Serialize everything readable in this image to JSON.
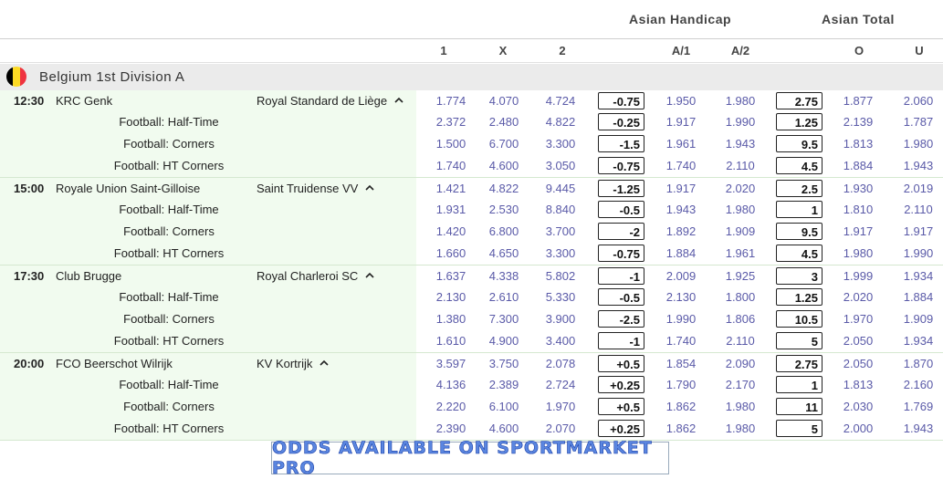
{
  "header": {
    "asian_handicap": "Asian Handicap",
    "asian_total": "Asian Total"
  },
  "columns": [
    "1",
    "X",
    "2",
    "A/1",
    "A/2",
    "O",
    "U"
  ],
  "league": {
    "name": "Belgium 1st Division A",
    "flag_colors": [
      "#000000",
      "#fdda24",
      "#ef3340"
    ]
  },
  "matches": [
    {
      "time": "12:30",
      "home": "KRC Genk",
      "away": "Royal Standard de Liège",
      "rows": [
        {
          "market": "",
          "odds": [
            "1.774",
            "4.070",
            "4.724"
          ],
          "ah": "-0.75",
          "a1": "1.950",
          "a2": "1.980",
          "total": "2.75",
          "o": "1.877",
          "u": "2.060"
        },
        {
          "market": "Football: Half-Time",
          "odds": [
            "2.372",
            "2.480",
            "4.822"
          ],
          "ah": "-0.25",
          "a1": "1.917",
          "a2": "1.990",
          "total": "1.25",
          "o": "2.139",
          "u": "1.787"
        },
        {
          "market": "Football: Corners",
          "odds": [
            "1.500",
            "6.700",
            "3.300"
          ],
          "ah": "-1.5",
          "a1": "1.961",
          "a2": "1.943",
          "total": "9.5",
          "o": "1.813",
          "u": "1.980"
        },
        {
          "market": "Football: HT Corners",
          "odds": [
            "1.740",
            "4.600",
            "3.050"
          ],
          "ah": "-0.75",
          "a1": "1.740",
          "a2": "2.110",
          "total": "4.5",
          "o": "1.884",
          "u": "1.943"
        }
      ]
    },
    {
      "time": "15:00",
      "home": "Royale Union Saint-Gilloise",
      "away": "Saint Truidense VV",
      "rows": [
        {
          "market": "",
          "odds": [
            "1.421",
            "4.822",
            "9.445"
          ],
          "ah": "-1.25",
          "a1": "1.917",
          "a2": "2.020",
          "total": "2.5",
          "o": "1.930",
          "u": "2.019"
        },
        {
          "market": "Football: Half-Time",
          "odds": [
            "1.931",
            "2.530",
            "8.840"
          ],
          "ah": "-0.5",
          "a1": "1.943",
          "a2": "1.980",
          "total": "1",
          "o": "1.810",
          "u": "2.110"
        },
        {
          "market": "Football: Corners",
          "odds": [
            "1.420",
            "6.800",
            "3.700"
          ],
          "ah": "-2",
          "a1": "1.892",
          "a2": "1.909",
          "total": "9.5",
          "o": "1.917",
          "u": "1.917"
        },
        {
          "market": "Football: HT Corners",
          "odds": [
            "1.660",
            "4.650",
            "3.300"
          ],
          "ah": "-0.75",
          "a1": "1.884",
          "a2": "1.961",
          "total": "4.5",
          "o": "1.980",
          "u": "1.990"
        }
      ]
    },
    {
      "time": "17:30",
      "home": "Club Brugge",
      "away": "Royal Charleroi SC",
      "rows": [
        {
          "market": "",
          "odds": [
            "1.637",
            "4.338",
            "5.802"
          ],
          "ah": "-1",
          "a1": "2.009",
          "a2": "1.925",
          "total": "3",
          "o": "1.999",
          "u": "1.934"
        },
        {
          "market": "Football: Half-Time",
          "odds": [
            "2.130",
            "2.610",
            "5.330"
          ],
          "ah": "-0.5",
          "a1": "2.130",
          "a2": "1.800",
          "total": "1.25",
          "o": "2.020",
          "u": "1.884"
        },
        {
          "market": "Football: Corners",
          "odds": [
            "1.380",
            "7.300",
            "3.900"
          ],
          "ah": "-2.5",
          "a1": "1.990",
          "a2": "1.806",
          "total": "10.5",
          "o": "1.970",
          "u": "1.909"
        },
        {
          "market": "Football: HT Corners",
          "odds": [
            "1.610",
            "4.900",
            "3.400"
          ],
          "ah": "-1",
          "a1": "1.740",
          "a2": "2.110",
          "total": "5",
          "o": "2.050",
          "u": "1.934"
        }
      ]
    },
    {
      "time": "20:00",
      "home": "FCO Beerschot Wilrijk",
      "away": "KV Kortrijk",
      "rows": [
        {
          "market": "",
          "odds": [
            "3.597",
            "3.750",
            "2.078"
          ],
          "ah": "+0.5",
          "a1": "1.854",
          "a2": "2.090",
          "total": "2.75",
          "o": "2.050",
          "u": "1.870"
        },
        {
          "market": "Football: Half-Time",
          "odds": [
            "4.136",
            "2.389",
            "2.724"
          ],
          "ah": "+0.25",
          "a1": "1.790",
          "a2": "2.170",
          "total": "1",
          "o": "1.813",
          "u": "2.160"
        },
        {
          "market": "Football: Corners",
          "odds": [
            "2.220",
            "6.100",
            "1.970"
          ],
          "ah": "+0.5",
          "a1": "1.862",
          "a2": "1.980",
          "total": "11",
          "o": "2.030",
          "u": "1.769"
        },
        {
          "market": "Football: HT Corners",
          "odds": [
            "2.390",
            "4.600",
            "2.070"
          ],
          "ah": "+0.25",
          "a1": "1.862",
          "a2": "1.980",
          "total": "5",
          "o": "2.000",
          "u": "1.943"
        }
      ]
    }
  ],
  "banner": {
    "text": "ODDS AVAILABLE ON SPORTMARKET PRO"
  }
}
